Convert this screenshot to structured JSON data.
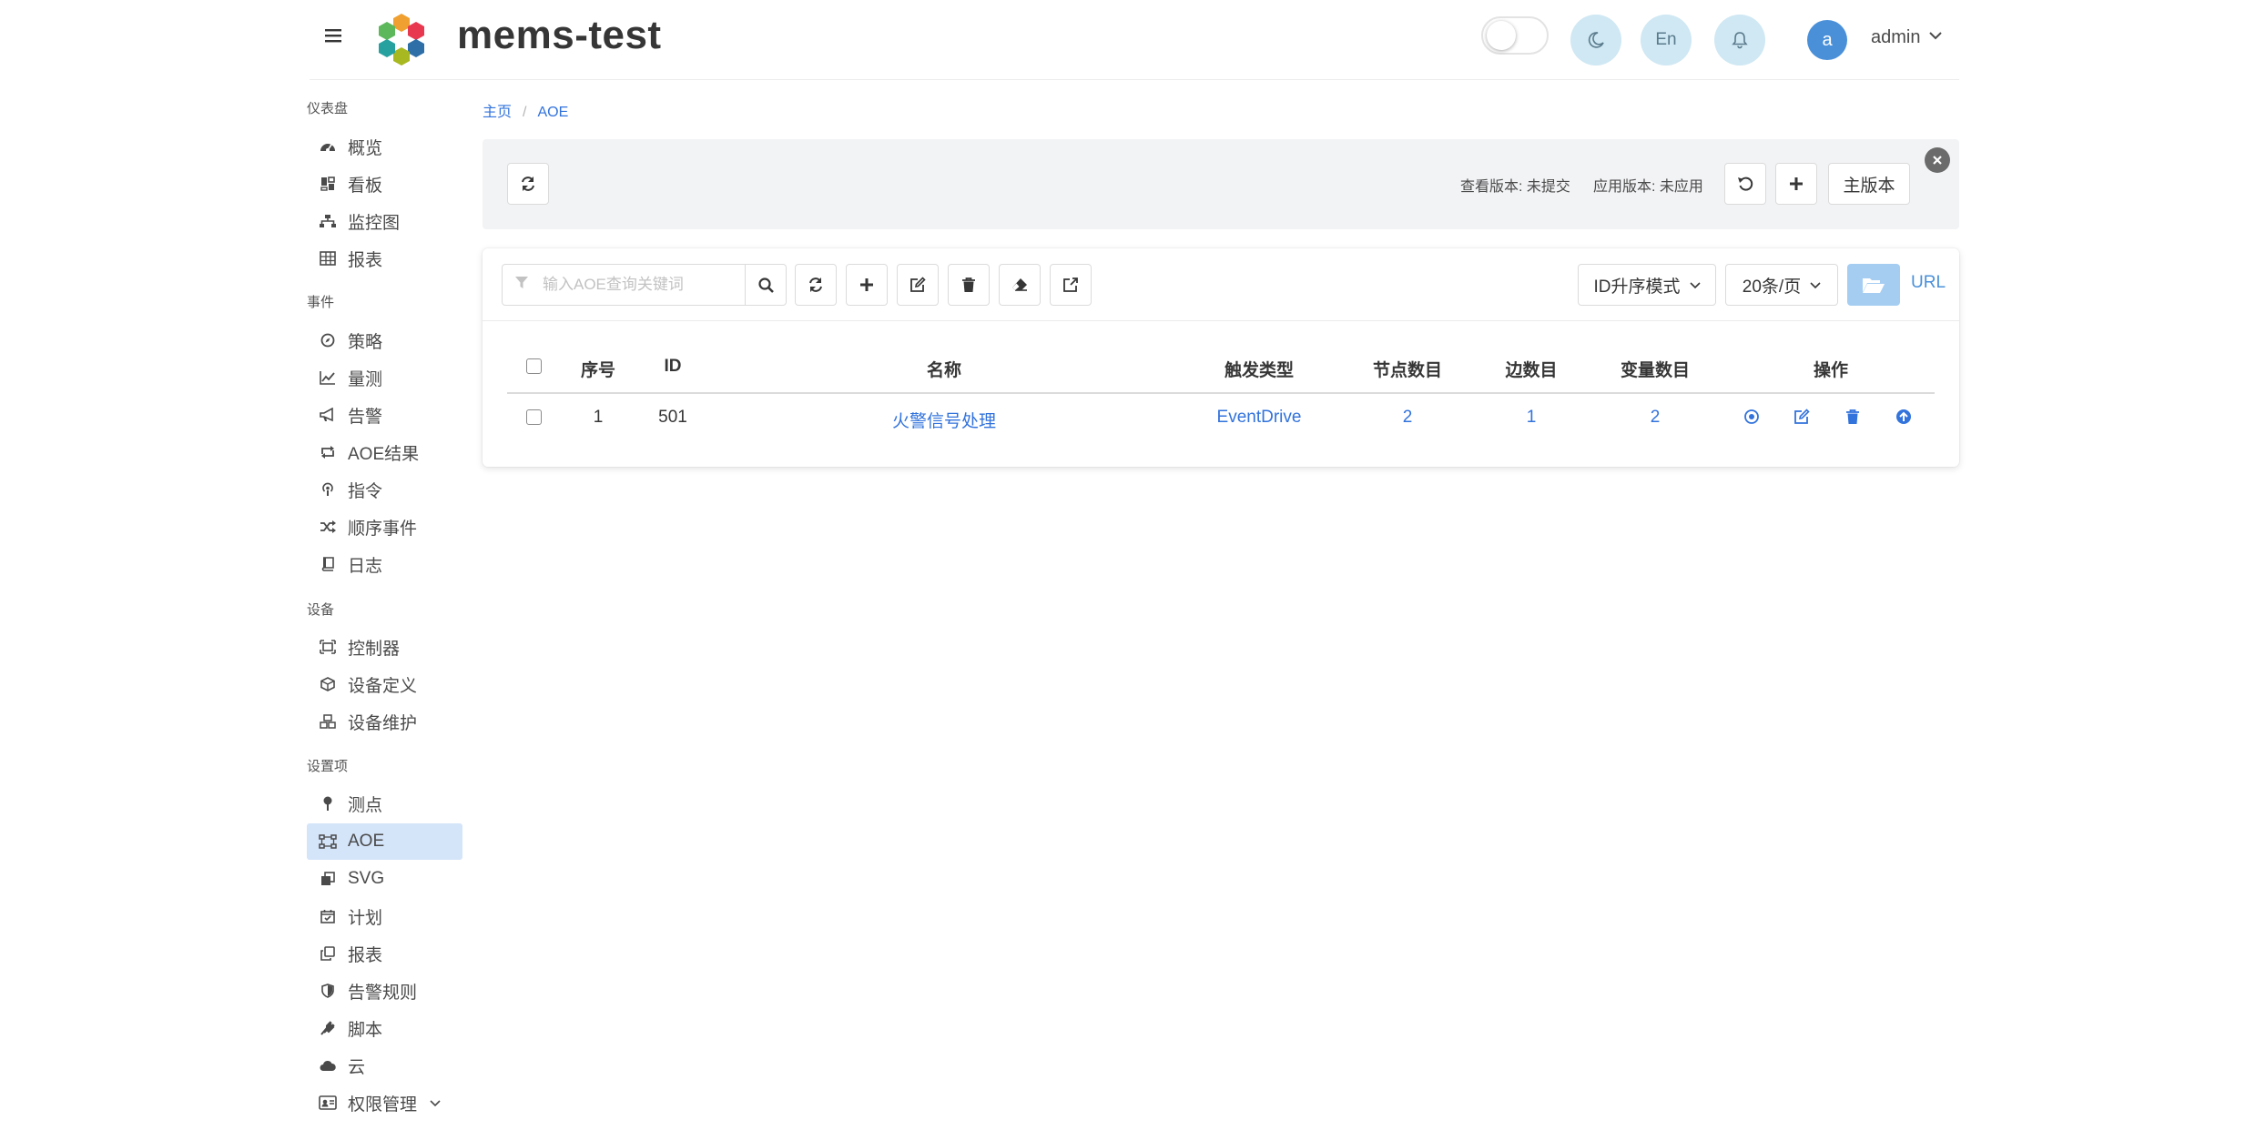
{
  "header": {
    "app_title": "mems-test",
    "lang_label": "En",
    "user_initial": "a",
    "user_name": "admin"
  },
  "sidebar": {
    "sections": [
      {
        "label": "仪表盘",
        "items": [
          {
            "label": "概览",
            "icon": "tachometer-icon"
          },
          {
            "label": "看板",
            "icon": "dashboard-icon"
          },
          {
            "label": "监控图",
            "icon": "sitemap-icon"
          },
          {
            "label": "报表",
            "icon": "table-icon"
          }
        ]
      },
      {
        "label": "事件",
        "items": [
          {
            "label": "策略",
            "icon": "compass-icon"
          },
          {
            "label": "量测",
            "icon": "chart-line-icon"
          },
          {
            "label": "告警",
            "icon": "bullhorn-icon"
          },
          {
            "label": "AOE结果",
            "icon": "retweet-icon"
          },
          {
            "label": "指令",
            "icon": "podcast-icon"
          },
          {
            "label": "顺序事件",
            "icon": "shuffle-icon"
          },
          {
            "label": "日志",
            "icon": "book-icon"
          }
        ]
      },
      {
        "label": "设备",
        "items": [
          {
            "label": "控制器",
            "icon": "expand-icon"
          },
          {
            "label": "设备定义",
            "icon": "cube-icon"
          },
          {
            "label": "设备维护",
            "icon": "cubes-icon"
          }
        ]
      },
      {
        "label": "设置项",
        "items": [
          {
            "label": "测点",
            "icon": "map-pin-icon"
          },
          {
            "label": "AOE",
            "icon": "project-diagram-icon",
            "active": true
          },
          {
            "label": "SVG",
            "icon": "clone-icon"
          },
          {
            "label": "计划",
            "icon": "calendar-check-icon"
          },
          {
            "label": "报表",
            "icon": "copy-icon"
          },
          {
            "label": "告警规则",
            "icon": "shield-icon"
          },
          {
            "label": "脚本",
            "icon": "plug-icon"
          },
          {
            "label": "云",
            "icon": "cloud-icon"
          },
          {
            "label": "权限管理",
            "icon": "id-card-icon",
            "has_submenu": true
          }
        ]
      }
    ]
  },
  "breadcrumb": {
    "home": "主页",
    "current": "AOE"
  },
  "version_bar": {
    "view_version": "查看版本: 未提交",
    "apply_version": "应用版本: 未应用",
    "main_version_label": "主版本"
  },
  "toolbar": {
    "search_placeholder": "输入AOE查询关键词",
    "sort_mode": "ID升序模式",
    "page_size": "20条/页",
    "url_label": "URL"
  },
  "table": {
    "columns": [
      "序号",
      "ID",
      "名称",
      "触发类型",
      "节点数目",
      "边数目",
      "变量数目",
      "操作"
    ],
    "rows": [
      {
        "index": "1",
        "id": "501",
        "name": "火警信号处理",
        "trigger": "EventDrive",
        "nodes": "2",
        "edges": "1",
        "vars": "2"
      }
    ]
  },
  "colors": {
    "accent": "#3273dc",
    "active_menu_bg": "#d4e4f9",
    "round_button_bg": "#cfe8f3",
    "folder_button_bg": "#a5cdf2"
  }
}
